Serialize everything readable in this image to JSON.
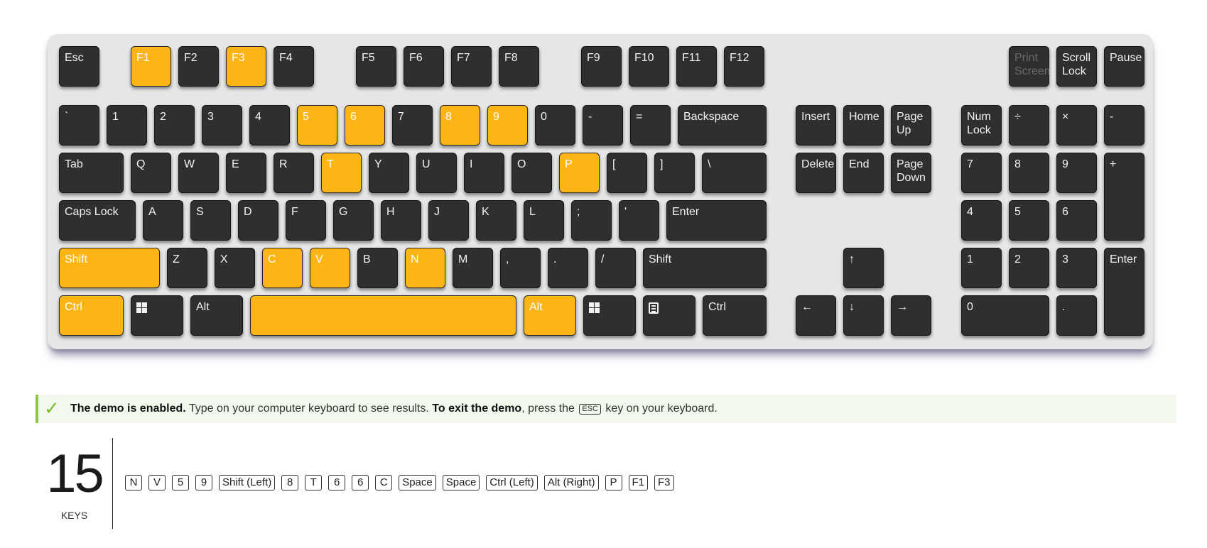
{
  "colors": {
    "highlight": "#fdb515",
    "key": "#2f2f2f",
    "board": "#e6e6e6",
    "notice_accent": "#8cc63f"
  },
  "keyboard": {
    "keys": [
      {
        "id": "esc",
        "label": "Esc",
        "hl": false
      },
      {
        "id": "f1",
        "label": "F1",
        "hl": true
      },
      {
        "id": "f2",
        "label": "F2",
        "hl": false
      },
      {
        "id": "f3",
        "label": "F3",
        "hl": true
      },
      {
        "id": "f4",
        "label": "F4",
        "hl": false
      },
      {
        "id": "f5",
        "label": "F5",
        "hl": false
      },
      {
        "id": "f6",
        "label": "F6",
        "hl": false
      },
      {
        "id": "f7",
        "label": "F7",
        "hl": false
      },
      {
        "id": "f8",
        "label": "F8",
        "hl": false
      },
      {
        "id": "f9",
        "label": "F9",
        "hl": false
      },
      {
        "id": "f10",
        "label": "F10",
        "hl": false
      },
      {
        "id": "f11",
        "label": "F11",
        "hl": false
      },
      {
        "id": "f12",
        "label": "F12",
        "hl": false
      },
      {
        "id": "printscreen",
        "label": "Print\nScreen",
        "hl": false,
        "dim": true
      },
      {
        "id": "scrolllock",
        "label": "Scroll\nLock",
        "hl": false
      },
      {
        "id": "pause",
        "label": "Pause",
        "hl": false
      },
      {
        "id": "backtick",
        "label": "`",
        "hl": false
      },
      {
        "id": "d1",
        "label": "1",
        "hl": false
      },
      {
        "id": "d2",
        "label": "2",
        "hl": false
      },
      {
        "id": "d3",
        "label": "3",
        "hl": false
      },
      {
        "id": "d4",
        "label": "4",
        "hl": false
      },
      {
        "id": "d5",
        "label": "5",
        "hl": true
      },
      {
        "id": "d6",
        "label": "6",
        "hl": true
      },
      {
        "id": "d7",
        "label": "7",
        "hl": false
      },
      {
        "id": "d8",
        "label": "8",
        "hl": true
      },
      {
        "id": "d9",
        "label": "9",
        "hl": true
      },
      {
        "id": "d0",
        "label": "0",
        "hl": false
      },
      {
        "id": "minus",
        "label": "-",
        "hl": false
      },
      {
        "id": "equals",
        "label": "=",
        "hl": false
      },
      {
        "id": "backspace",
        "label": "Backspace",
        "hl": false
      },
      {
        "id": "insert",
        "label": "Insert",
        "hl": false
      },
      {
        "id": "home",
        "label": "Home",
        "hl": false
      },
      {
        "id": "pageup",
        "label": "Page\nUp",
        "hl": false
      },
      {
        "id": "numlock",
        "label": "Num\nLock",
        "hl": false
      },
      {
        "id": "numdiv",
        "label": "÷",
        "hl": false
      },
      {
        "id": "nummul",
        "label": "×",
        "hl": false
      },
      {
        "id": "numminus",
        "label": "-",
        "hl": false
      },
      {
        "id": "tab",
        "label": "Tab",
        "hl": false
      },
      {
        "id": "q",
        "label": "Q",
        "hl": false
      },
      {
        "id": "w",
        "label": "W",
        "hl": false
      },
      {
        "id": "e",
        "label": "E",
        "hl": false
      },
      {
        "id": "r",
        "label": "R",
        "hl": false
      },
      {
        "id": "t",
        "label": "T",
        "hl": true
      },
      {
        "id": "y",
        "label": "Y",
        "hl": false
      },
      {
        "id": "u",
        "label": "U",
        "hl": false
      },
      {
        "id": "i",
        "label": "I",
        "hl": false
      },
      {
        "id": "o",
        "label": "O",
        "hl": false
      },
      {
        "id": "p",
        "label": "P",
        "hl": true
      },
      {
        "id": "lbracket",
        "label": "[",
        "hl": false
      },
      {
        "id": "rbracket",
        "label": "]",
        "hl": false
      },
      {
        "id": "backslash",
        "label": "\\",
        "hl": false
      },
      {
        "id": "delete",
        "label": "Delete",
        "hl": false
      },
      {
        "id": "end",
        "label": "End",
        "hl": false
      },
      {
        "id": "pagedown",
        "label": "Page\nDown",
        "hl": false
      },
      {
        "id": "num7",
        "label": "7",
        "hl": false
      },
      {
        "id": "num8",
        "label": "8",
        "hl": false
      },
      {
        "id": "num9",
        "label": "9",
        "hl": false
      },
      {
        "id": "numplus",
        "label": "+",
        "hl": false
      },
      {
        "id": "capslock",
        "label": "Caps Lock",
        "hl": false
      },
      {
        "id": "a",
        "label": "A",
        "hl": false
      },
      {
        "id": "s",
        "label": "S",
        "hl": false
      },
      {
        "id": "d",
        "label": "D",
        "hl": false
      },
      {
        "id": "f",
        "label": "F",
        "hl": false
      },
      {
        "id": "g",
        "label": "G",
        "hl": false
      },
      {
        "id": "h",
        "label": "H",
        "hl": false
      },
      {
        "id": "j",
        "label": "J",
        "hl": false
      },
      {
        "id": "k",
        "label": "K",
        "hl": false
      },
      {
        "id": "l",
        "label": "L",
        "hl": false
      },
      {
        "id": "semicolon",
        "label": ";",
        "hl": false
      },
      {
        "id": "quote",
        "label": "'",
        "hl": false
      },
      {
        "id": "enter",
        "label": "Enter",
        "hl": false
      },
      {
        "id": "num4",
        "label": "4",
        "hl": false
      },
      {
        "id": "num5",
        "label": "5",
        "hl": false
      },
      {
        "id": "num6",
        "label": "6",
        "hl": false
      },
      {
        "id": "lshift",
        "label": "Shift",
        "hl": true
      },
      {
        "id": "z",
        "label": "Z",
        "hl": false
      },
      {
        "id": "x",
        "label": "X",
        "hl": false
      },
      {
        "id": "c",
        "label": "C",
        "hl": true
      },
      {
        "id": "v",
        "label": "V",
        "hl": true
      },
      {
        "id": "b",
        "label": "B",
        "hl": false
      },
      {
        "id": "n",
        "label": "N",
        "hl": true
      },
      {
        "id": "m",
        "label": "M",
        "hl": false
      },
      {
        "id": "comma",
        "label": ",",
        "hl": false
      },
      {
        "id": "period",
        "label": ".",
        "hl": false
      },
      {
        "id": "slash",
        "label": "/",
        "hl": false
      },
      {
        "id": "rshift",
        "label": "Shift",
        "hl": false
      },
      {
        "id": "up",
        "label": "↑",
        "hl": false
      },
      {
        "id": "num1",
        "label": "1",
        "hl": false
      },
      {
        "id": "num2",
        "label": "2",
        "hl": false
      },
      {
        "id": "num3",
        "label": "3",
        "hl": false
      },
      {
        "id": "numenter",
        "label": "Enter",
        "hl": false
      },
      {
        "id": "lctrl",
        "label": "Ctrl",
        "hl": true
      },
      {
        "id": "lwin",
        "label": "",
        "icon": "windows-icon",
        "hl": false
      },
      {
        "id": "lalt",
        "label": "Alt",
        "hl": false
      },
      {
        "id": "space",
        "label": "",
        "hl": true
      },
      {
        "id": "ralt",
        "label": "Alt",
        "hl": true
      },
      {
        "id": "rwin",
        "label": "",
        "icon": "windows-icon",
        "hl": false
      },
      {
        "id": "menu",
        "label": "",
        "icon": "menu-icon",
        "hl": false
      },
      {
        "id": "rctrl",
        "label": "Ctrl",
        "hl": false
      },
      {
        "id": "left",
        "label": "←",
        "hl": false
      },
      {
        "id": "down",
        "label": "↓",
        "hl": false
      },
      {
        "id": "right",
        "label": "→",
        "hl": false
      },
      {
        "id": "num0",
        "label": "0",
        "hl": false
      },
      {
        "id": "numdot",
        "label": ".",
        "hl": false
      }
    ]
  },
  "notice": {
    "icon": "check-icon",
    "check": "✓",
    "bold1": "The demo is enabled.",
    "text1": " Type on your computer keyboard to see results. ",
    "bold2": "To exit the demo",
    "text2": ", press the ",
    "esc": "ESC",
    "text3": " key on your keyboard."
  },
  "counter": {
    "value": "15",
    "label": "KEYS"
  },
  "log": [
    "N",
    "V",
    "5",
    "9",
    "Shift (Left)",
    "8",
    "T",
    "6",
    "6",
    "C",
    "Space",
    "Space",
    "Ctrl (Left)",
    "Alt (Right)",
    "P",
    "F1",
    "F3"
  ]
}
